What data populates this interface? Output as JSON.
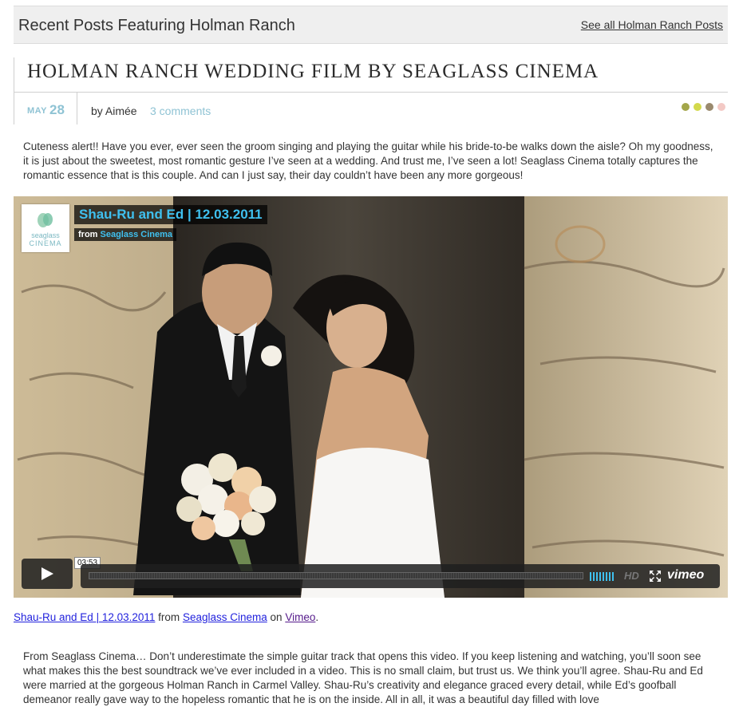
{
  "recent": {
    "title": "Recent Posts Featuring Holman Ranch",
    "link": "See all Holman Ranch Posts"
  },
  "post": {
    "title": "HOLMAN RANCH WEDDING FILM BY SEAGLASS CINEMA",
    "date_month": "MAY",
    "date_day": "28",
    "byline": "by Aimée",
    "comments": "3 comments",
    "dot_colors": [
      "#a3a64a",
      "#d3d94c",
      "#9a8a6e",
      "#f3c9c5"
    ],
    "intro": "Cuteness alert!! Have you ever, ever seen the groom singing and playing the guitar while his bride-to-be walks down the aisle? Oh my goodness, it is just about the sweetest, most romantic gesture I’ve seen at a wedding. And trust me, I’ve seen a lot! Seaglass Cinema totally captures the romantic essence that is this couple. And can I just say, their day couldn’t have been any more gorgeous!"
  },
  "video": {
    "badge_line1": "seaglass",
    "badge_line2": "CINEMA",
    "title": "Shau-Ru and Ed | 12.03.2011",
    "from_label": "from",
    "from_name": "Seaglass Cinema",
    "time": "03:53",
    "hd_label": "HD",
    "brand": "vimeo",
    "accent_color": "#3fc0ef"
  },
  "credit": {
    "video_link": "Shau-Ru and Ed | 12.03.2011",
    "from_word": "from",
    "author_link": "Seaglass Cinema",
    "on_word": "on",
    "site_link": "Vimeo",
    "period": "."
  },
  "body": {
    "text": "From Seaglass Cinema… Don’t underestimate the simple guitar track that opens this video. If you keep listening and watching, you’ll soon see what makes this the best soundtrack we’ve ever included in a video. This is no small claim, but trust us. We think you’ll agree. Shau-Ru and Ed were married at the gorgeous Holman Ranch in Carmel Valley. Shau-Ru’s creativity and elegance graced every detail, while Ed’s goofball demeanor really gave way to the hopeless romantic that he is on the inside. All in all, it was a beautiful day filled with love"
  }
}
